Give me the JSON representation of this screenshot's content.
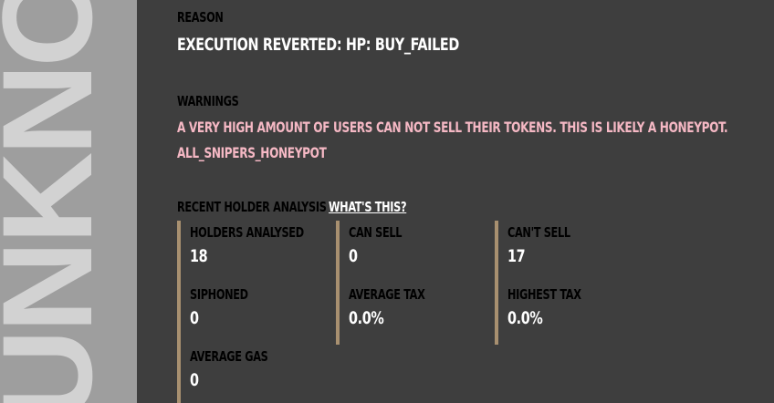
{
  "banner": {
    "text": "UNKNOWN"
  },
  "reason": {
    "label": "Reason",
    "value": "Execution reverted: HP: BUY_FAILED"
  },
  "warnings": {
    "label": "Warnings",
    "items": [
      "A very high amount of users can not sell their tokens. This is likely a honeypot.",
      "ALL_SNIPERS_HONEYPOT"
    ]
  },
  "holder_analysis": {
    "label": "Recent Holder Analysis",
    "link": "What's this?",
    "stats": [
      {
        "label": "Holders Analysed",
        "value": "18"
      },
      {
        "label": "Can Sell",
        "value": "0"
      },
      {
        "label": "Can't Sell",
        "value": "17"
      },
      {
        "label": "Siphoned",
        "value": "0"
      },
      {
        "label": "Average Tax",
        "value": "0.0%"
      },
      {
        "label": "Highest Tax",
        "value": "0.0%"
      },
      {
        "label": "Average Gas",
        "value": "0"
      }
    ]
  },
  "colors": {
    "background": "#3e3e3e",
    "banner": "#9e9e9e",
    "banner_text": "#d2d2d2",
    "warning_text": "#f5b8c4",
    "accent_border": "#a89070"
  }
}
